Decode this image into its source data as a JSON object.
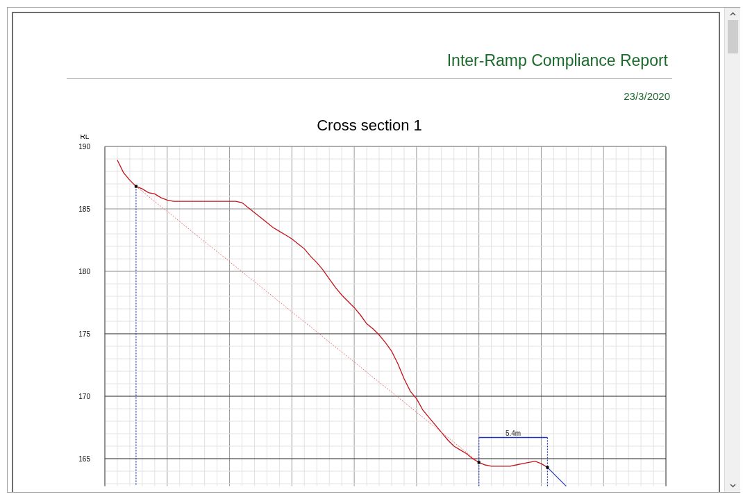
{
  "report": {
    "title": "Inter-Ramp Compliance Report",
    "date": "23/3/2020"
  },
  "chart": {
    "chart_data": {
      "type": "line",
      "title": "Cross section 1",
      "ylabel": "RL",
      "ylim": [
        162.8,
        190
      ],
      "grid": true,
      "yticks": [
        165,
        170,
        175,
        180,
        185,
        190
      ],
      "categories": [
        null,
        null,
        null,
        null,
        null,
        null,
        null,
        null,
        null,
        null,
        null,
        null,
        null,
        null,
        null,
        null,
        null,
        null,
        null,
        null,
        null,
        null,
        null,
        null,
        null,
        null,
        null,
        null,
        null,
        null,
        null,
        null,
        null,
        null,
        null,
        null,
        null,
        null,
        null,
        null,
        null,
        null,
        null,
        null,
        null,
        null,
        null,
        null,
        null,
        null,
        null,
        null,
        null,
        null,
        null,
        null,
        null,
        null,
        null,
        null,
        null,
        null,
        null,
        null,
        null,
        null,
        null,
        null,
        null,
        null,
        null,
        null,
        null
      ],
      "series": [
        {
          "color": "#c0141c",
          "line_style": "solid",
          "values": [
            188.9,
            187.9,
            187.3,
            186.8,
            186.6,
            186.3,
            186.2,
            185.9,
            185.7,
            185.6,
            185.6,
            185.6,
            185.6,
            185.6,
            185.6,
            185.6,
            185.6,
            185.6,
            185.6,
            185.6,
            185.5,
            185.1,
            184.7,
            184.3,
            183.9,
            183.5,
            183.2,
            182.9,
            182.6,
            182.2,
            181.8,
            181.2,
            180.7,
            180.1,
            179.4,
            178.7,
            178.1,
            177.6,
            177.1,
            176.5,
            175.8,
            175.4,
            174.9,
            174.3,
            173.6,
            172.6,
            171.4,
            170.4,
            169.8,
            168.9,
            168.3,
            167.7,
            167.1,
            166.5,
            166.0,
            165.7,
            165.4,
            165.0,
            164.7,
            164.5,
            164.4,
            164.4,
            164.4,
            164.4,
            164.5,
            164.6,
            164.7,
            164.8,
            164.6,
            164.3,
            null,
            null,
            null
          ]
        },
        {
          "color": "#f06a6a",
          "line_style": "dashed",
          "values": [
            null,
            null,
            null,
            186.8,
            186.4,
            186.0,
            185.59,
            185.19,
            184.79,
            184.39,
            183.99,
            183.59,
            183.18,
            182.78,
            182.38,
            181.98,
            181.58,
            181.17,
            180.77,
            180.37,
            179.97,
            179.57,
            179.17,
            178.76,
            178.36,
            177.96,
            177.56,
            177.16,
            176.76,
            176.35,
            175.95,
            175.55,
            175.15,
            174.75,
            174.34,
            173.94,
            173.54,
            173.14,
            172.74,
            172.34,
            171.93,
            171.53,
            171.13,
            170.73,
            170.33,
            169.92,
            169.52,
            169.12,
            168.72,
            168.32,
            167.92,
            167.51,
            167.11,
            166.71,
            166.31,
            165.91,
            165.51,
            165.1,
            164.7,
            null,
            null,
            null,
            null,
            null,
            null,
            null,
            null,
            null,
            null,
            null,
            null,
            null,
            null
          ]
        },
        {
          "color": "#2a3fc0",
          "line_style": "solid",
          "values": [
            null,
            null,
            null,
            null,
            null,
            null,
            null,
            null,
            null,
            null,
            null,
            null,
            null,
            null,
            null,
            null,
            null,
            null,
            null,
            null,
            null,
            null,
            null,
            null,
            null,
            null,
            null,
            null,
            null,
            null,
            null,
            null,
            null,
            null,
            null,
            null,
            null,
            null,
            null,
            null,
            null,
            null,
            null,
            null,
            null,
            null,
            null,
            null,
            null,
            null,
            null,
            null,
            null,
            null,
            null,
            null,
            null,
            null,
            null,
            null,
            null,
            null,
            null,
            null,
            null,
            null,
            null,
            null,
            null,
            164.3,
            163.8,
            163.3,
            162.8
          ]
        }
      ],
      "annotations": [
        "5.4m"
      ]
    }
  }
}
